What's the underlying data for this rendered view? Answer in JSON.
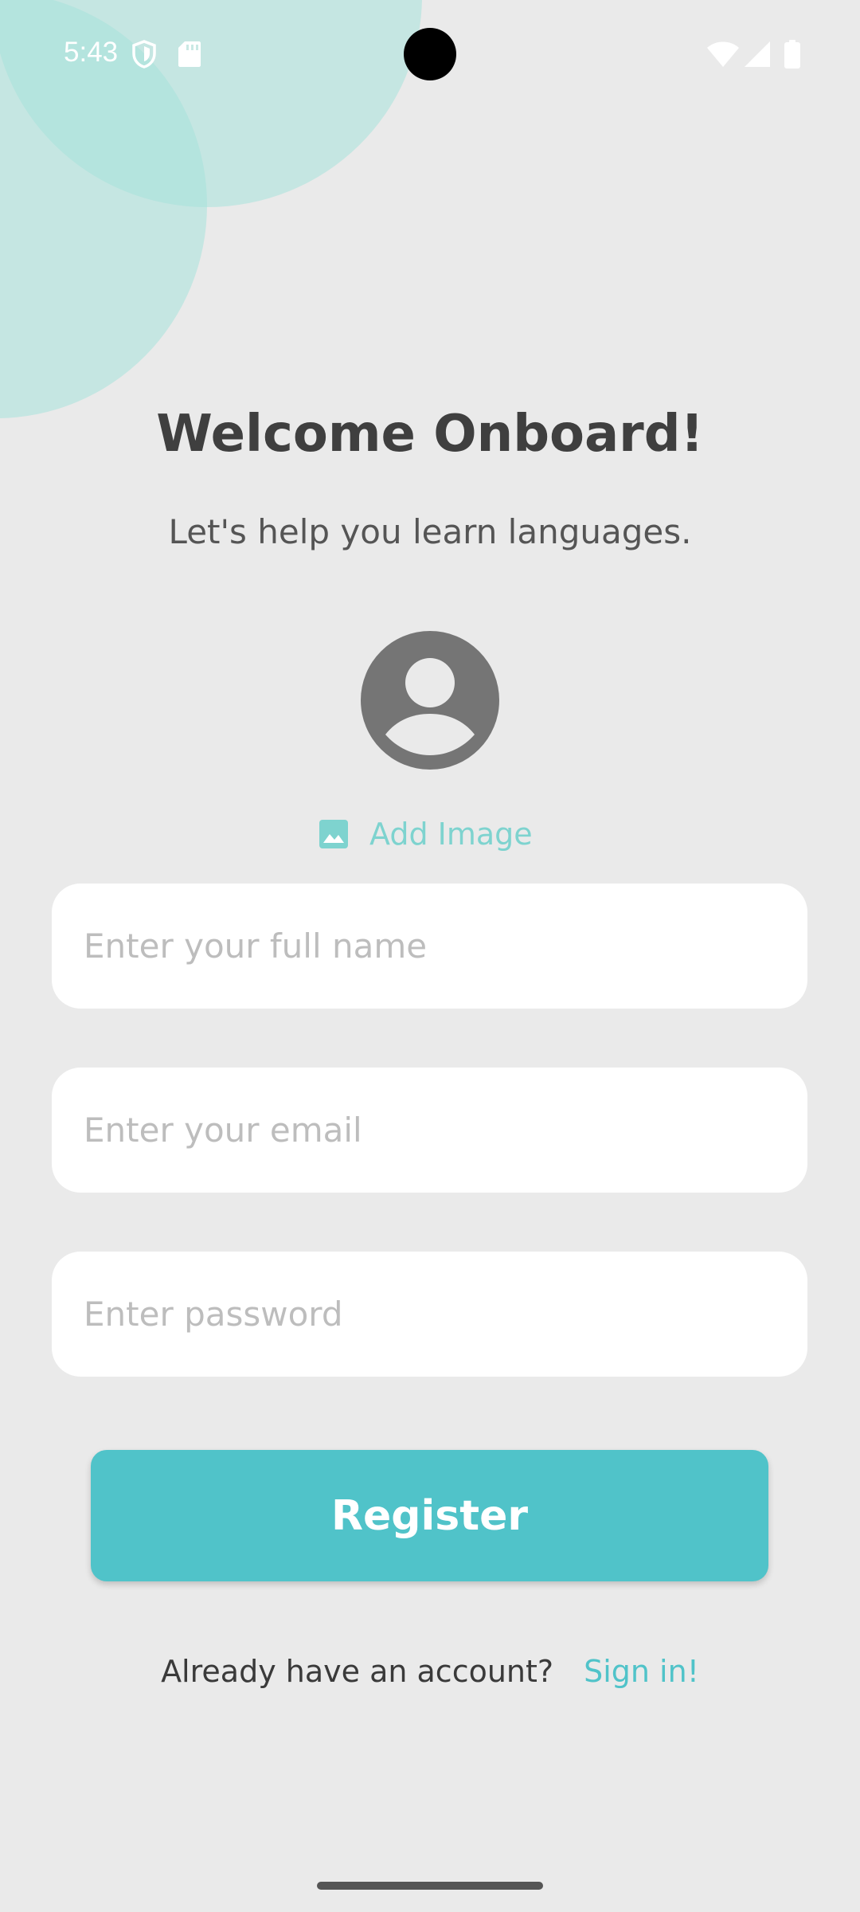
{
  "status_bar": {
    "time": "5:43",
    "icons": [
      "shield-icon",
      "sd-card-icon",
      "wifi-icon",
      "cellular-signal-icon",
      "battery-icon"
    ]
  },
  "header": {
    "title": "Welcome Onboard!",
    "subtitle": "Let's help you learn languages."
  },
  "avatar": {
    "icon": "account-circle-icon",
    "color": "#757575"
  },
  "add_image": {
    "icon": "image-icon",
    "label": "Add Image"
  },
  "form": {
    "full_name": {
      "placeholder": "Enter your full name",
      "value": ""
    },
    "email": {
      "placeholder": "Enter your email",
      "value": ""
    },
    "password": {
      "placeholder": "Enter password",
      "value": ""
    }
  },
  "register_button": {
    "label": "Register"
  },
  "signin": {
    "prompt": "Already have an account?",
    "link": "Sign in!"
  },
  "colors": {
    "background": "#EAEAEA",
    "accent": "#50C3C9",
    "bubble": "#A5E2DA",
    "text_dark": "#3F3F3F",
    "placeholder": "#BDBDBD"
  }
}
